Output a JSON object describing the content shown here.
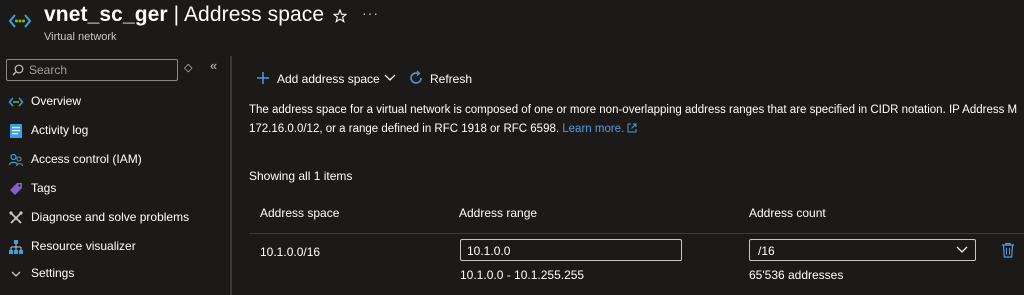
{
  "header": {
    "resource_name": "vnet_sc_ger",
    "separator": " | ",
    "page_name": "Address space",
    "subtitle": "Virtual network",
    "more_label": "···"
  },
  "sidebar": {
    "search_placeholder": "Search",
    "collapse_toggle": "◇",
    "collapse_all": "«",
    "items": [
      {
        "label": "Overview",
        "icon": "vnet-icon"
      },
      {
        "label": "Activity log",
        "icon": "activity-log-icon"
      },
      {
        "label": "Access control (IAM)",
        "icon": "people-icon"
      },
      {
        "label": "Tags",
        "icon": "tag-icon"
      },
      {
        "label": "Diagnose and solve problems",
        "icon": "wrench-icon"
      },
      {
        "label": "Resource visualizer",
        "icon": "hierarchy-icon"
      },
      {
        "label": "Settings",
        "icon": "chevron-down-icon"
      }
    ]
  },
  "toolbar": {
    "add_label": "Add address space",
    "refresh_label": "Refresh"
  },
  "description": {
    "line1": "The address space for a virtual network is composed of one or more non-overlapping address ranges that are specified in CIDR notation. IP Address M",
    "line2": "172.16.0.0/12, or a range defined in RFC 1918 or RFC 6598. ",
    "learn_more": "Learn more."
  },
  "table": {
    "summary": "Showing all 1 items",
    "columns": [
      "Address space",
      "Address range",
      "Address count"
    ],
    "rows": [
      {
        "address_space": "10.1.0.0/16",
        "range_input_value": "10.1.0.0",
        "range_span": "10.1.0.0 - 10.1.255.255",
        "count_select_value": "/16",
        "count_text": "65'536 addresses"
      }
    ]
  },
  "colors": {
    "background": "#1b1a19",
    "accent": "#4f9dde",
    "text": "#ffffff",
    "muted": "#c8c6c4"
  }
}
